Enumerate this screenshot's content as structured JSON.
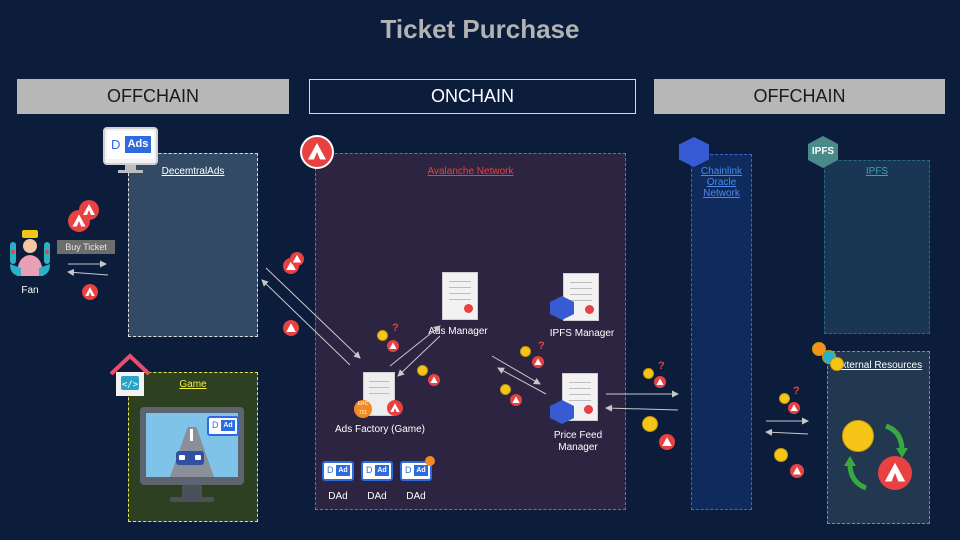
{
  "title": "Ticket Purchase",
  "bands": {
    "left": "OFFCHAIN",
    "center": "ONCHAIN",
    "right": "OFFCHAIN"
  },
  "containers": {
    "decentral_ads": "DecemtralAds",
    "game": "Game",
    "avalanche": "Avalanche Network",
    "chainlink": "Chainlink Oracle Network",
    "ipfs": "IPFS",
    "external": "External Resources"
  },
  "nodes": {
    "fan": "Fan",
    "buy_ticket": "Buy Ticket",
    "ads_manager": "Ads Manager",
    "ipfs_manager": "IPFS Manager",
    "ads_factory": "Ads Factory (Game)",
    "price_feed": "Price Feed Manager",
    "dad_1": "DAd",
    "dad_2": "DAd",
    "dad_3": "DAd"
  },
  "icons": {
    "ads_logo_d": "D",
    "ads_logo_text": "Ads",
    "ipfs_logo": "IPFS",
    "dad_d": "D",
    "dad_ad": "Ad",
    "game_ad_d": "D",
    "game_ad_text": "Ad",
    "question": "?",
    "erc_badge": "ERC 721"
  },
  "colors": {
    "background": "#0b1d3b",
    "avalanche_red": "#e84142",
    "decentral_box": "#324a63",
    "game_box": "#2e4022",
    "avalanche_box": "#2c2440",
    "chainlink_box": "#0f2a5c",
    "ipfs_box": "#193654",
    "external_box": "#213850"
  }
}
